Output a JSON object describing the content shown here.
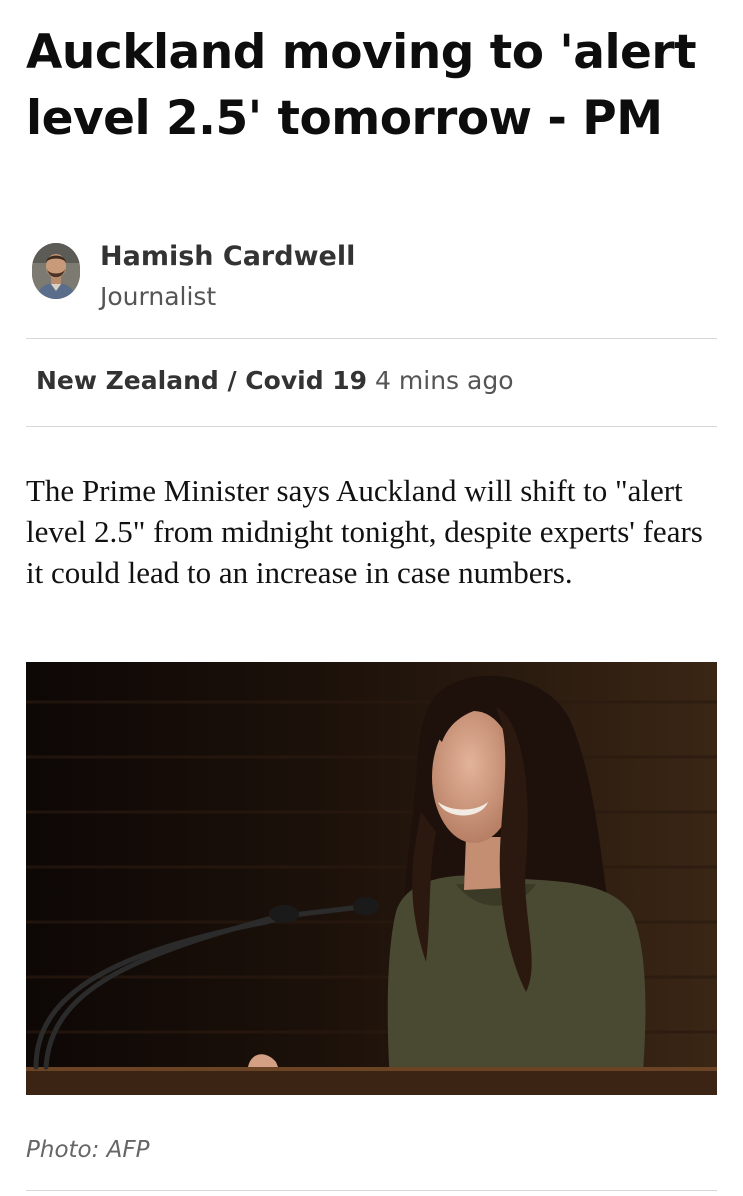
{
  "article": {
    "headline": "Auckland moving to 'alert level 2.5' tomorrow - PM",
    "lede": "The Prime Minister says Auckland will shift to \"alert level 2.5\" from midnight tonight, despite experts' fears it could lead to an increase in case numbers.",
    "photo_caption": "Photo: AFP"
  },
  "author": {
    "name": "Hamish Cardwell",
    "role": "Journalist",
    "avatar_icon": "author-portrait"
  },
  "meta": {
    "section": "New Zealand / Covid 19",
    "timestamp": "4 mins ago"
  },
  "colors": {
    "text": "#111111",
    "rule": "#d8d8d8",
    "photo_background": "#1a0e09"
  }
}
